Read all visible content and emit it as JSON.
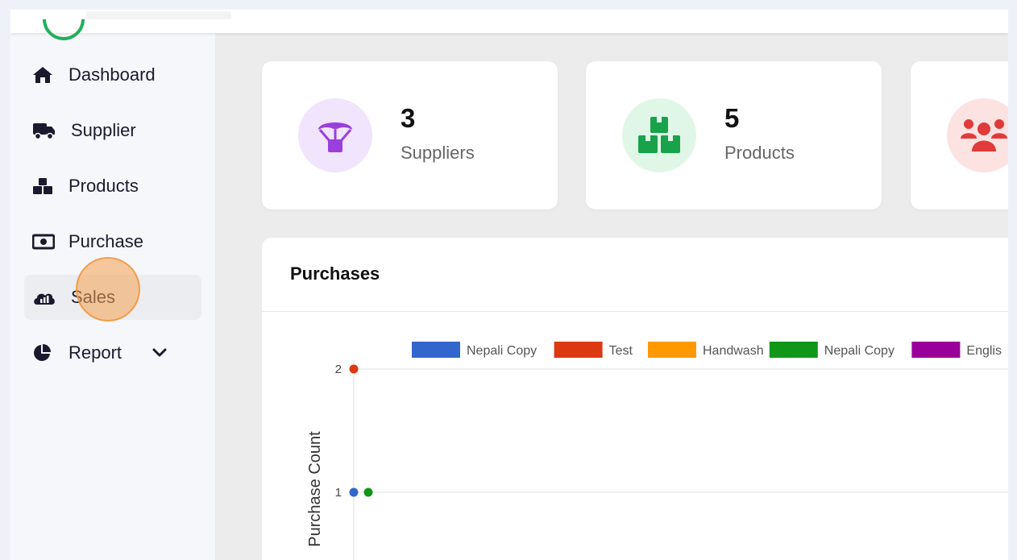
{
  "sidebar": {
    "items": [
      {
        "label": "Dashboard",
        "icon": "home-icon"
      },
      {
        "label": "Supplier",
        "icon": "truck-icon"
      },
      {
        "label": "Products",
        "icon": "boxes-icon"
      },
      {
        "label": "Purchase",
        "icon": "money-bill-icon"
      },
      {
        "label": "Sales",
        "icon": "cloud-chart-icon",
        "active": true
      },
      {
        "label": "Report",
        "icon": "pie-chart-icon",
        "has_dropdown": true
      }
    ]
  },
  "cards": [
    {
      "value": "3",
      "label": "Suppliers",
      "icon": "parachute-box-icon",
      "icon_color": "#9a3fdc",
      "icon_bg": "#f1e4fd"
    },
    {
      "value": "5",
      "label": "Products",
      "icon": "boxes-icon",
      "icon_color": "#18a34a",
      "icon_bg": "#e0f7e8"
    },
    {
      "value": "",
      "label": "",
      "icon": "users-icon",
      "icon_color": "#e03a3a",
      "icon_bg": "#fde2e2"
    }
  ],
  "panel": {
    "title": "Purchases"
  },
  "chart_data": {
    "type": "scatter",
    "ylabel": "Purchase Count",
    "yticks": [
      "2",
      "1"
    ],
    "series": [
      {
        "name": "Nepali Copy",
        "color": "#3366cc",
        "points": [
          [
            0,
            1
          ]
        ]
      },
      {
        "name": "Test",
        "color": "#dc3912",
        "points": [
          [
            0,
            2
          ]
        ]
      },
      {
        "name": "Handwash",
        "color": "#ff9900",
        "points": []
      },
      {
        "name": "Nepali Copy",
        "color": "#109618",
        "points": [
          [
            1,
            1
          ]
        ]
      },
      {
        "name": "Englis",
        "color": "#990099",
        "points": []
      }
    ]
  }
}
